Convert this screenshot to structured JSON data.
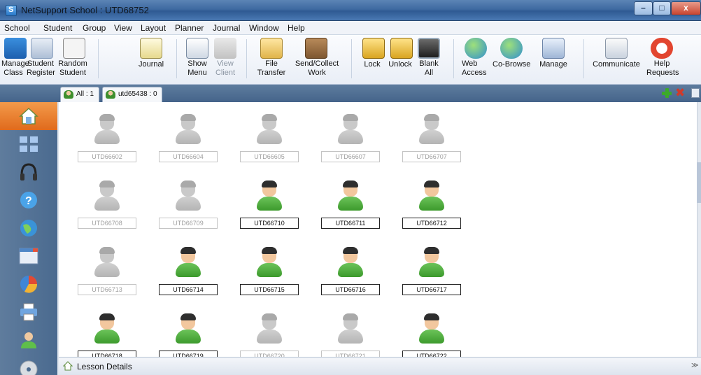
{
  "window": {
    "title": "NetSupport School : UTD68752"
  },
  "menu": [
    "School",
    "Student",
    "Group",
    "View",
    "Layout",
    "Planner",
    "Journal",
    "Window",
    "Help"
  ],
  "toolbar": {
    "manage_class": "Manage\nClass",
    "student_register": "Student\nRegister",
    "random_student": "Random\nStudent",
    "journal": "Journal",
    "show_menu": "Show\nMenu",
    "view_client": "View\nClient",
    "file_transfer": "File\nTransfer",
    "send_collect": "Send/Collect\nWork",
    "lock": "Lock",
    "unlock": "Unlock",
    "blank_all": "Blank\nAll",
    "web_access": "Web\nAccess",
    "co_browse": "Co-Browse",
    "manage": "Manage",
    "communicate": "Communicate",
    "help_requests": "Help\nRequests"
  },
  "groups": [
    {
      "label": "All : 1"
    },
    {
      "label": "utd65438 : 0"
    }
  ],
  "clients": [
    {
      "name": "UTD66602",
      "online": false
    },
    {
      "name": "UTD66604",
      "online": false
    },
    {
      "name": "UTD66605",
      "online": false
    },
    {
      "name": "UTD66607",
      "online": false
    },
    {
      "name": "UTD66707",
      "online": false
    },
    {
      "name": "UTD66708",
      "online": false
    },
    {
      "name": "UTD66709",
      "online": false
    },
    {
      "name": "UTD66710",
      "online": true
    },
    {
      "name": "UTD66711",
      "online": true
    },
    {
      "name": "UTD66712",
      "online": true
    },
    {
      "name": "UTD66713",
      "online": false
    },
    {
      "name": "UTD66714",
      "online": true
    },
    {
      "name": "UTD66715",
      "online": true
    },
    {
      "name": "UTD66716",
      "online": true
    },
    {
      "name": "UTD66717",
      "online": true
    },
    {
      "name": "UTD66718",
      "online": true
    },
    {
      "name": "UTD66719",
      "online": true
    },
    {
      "name": "UTD66720",
      "online": false
    },
    {
      "name": "UTD66721",
      "online": false
    },
    {
      "name": "UTD66722",
      "online": true
    }
  ],
  "bottom": {
    "lesson_details": "Lesson Details"
  },
  "colors": {
    "accent": "#e06a1c",
    "online": "#3c9a2c",
    "sidebar": "#4a6a8f"
  }
}
